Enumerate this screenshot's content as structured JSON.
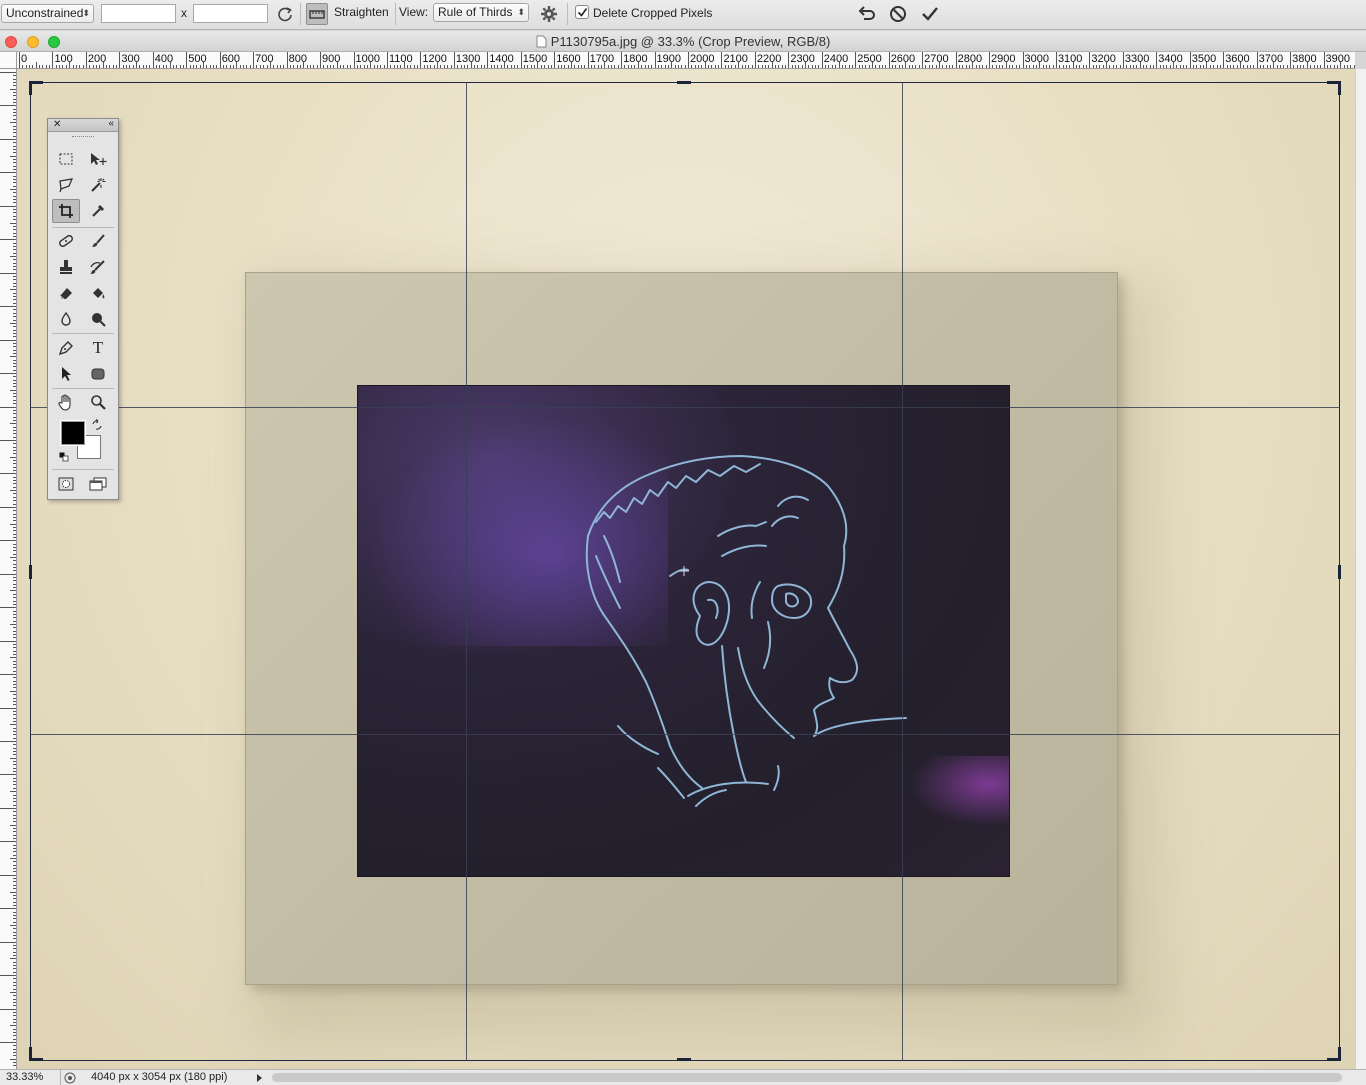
{
  "options_bar": {
    "ratio_preset": "Unconstrained",
    "width_value": "",
    "height_value": "",
    "times_symbol": "x",
    "straighten_label": "Straighten",
    "view_label": "View:",
    "view_mode": "Rule of Thirds",
    "delete_cropped_label": "Delete Cropped Pixels",
    "delete_cropped_checked": true
  },
  "document": {
    "title": "P1130795a.jpg @ 33.3% (Crop Preview, RGB/8)"
  },
  "ruler_h": [
    "0",
    "100",
    "200",
    "300",
    "400",
    "500",
    "600",
    "700",
    "800",
    "900",
    "1000",
    "1100",
    "1200",
    "1300",
    "1400",
    "1500",
    "1600",
    "1700",
    "1800",
    "1900",
    "2000",
    "2100",
    "2200",
    "2300",
    "2400",
    "2500",
    "2600",
    "2700",
    "2800",
    "2900",
    "3000",
    "3100",
    "3200",
    "3300",
    "3400",
    "3500",
    "3600",
    "3700",
    "3800",
    "3900"
  ],
  "status": {
    "zoom": "33.33%",
    "doc_info": "4040 px x 3054 px (180 ppi)"
  },
  "colors": {
    "foreground": "#000000",
    "background": "#ffffff",
    "crop_guides": "#3a4052",
    "drawing_lines": "#8fb6d6"
  },
  "tools": [
    "rectangular-marquee",
    "move",
    "lasso",
    "quick-selection",
    "crop",
    "eyedropper",
    "spot-healing-brush",
    "brush",
    "clone-stamp",
    "history-brush",
    "eraser",
    "paint-bucket",
    "blur",
    "dodge",
    "pen",
    "type",
    "path-selection",
    "rectangle",
    "hand",
    "zoom"
  ],
  "tool_type_glyph": "T"
}
